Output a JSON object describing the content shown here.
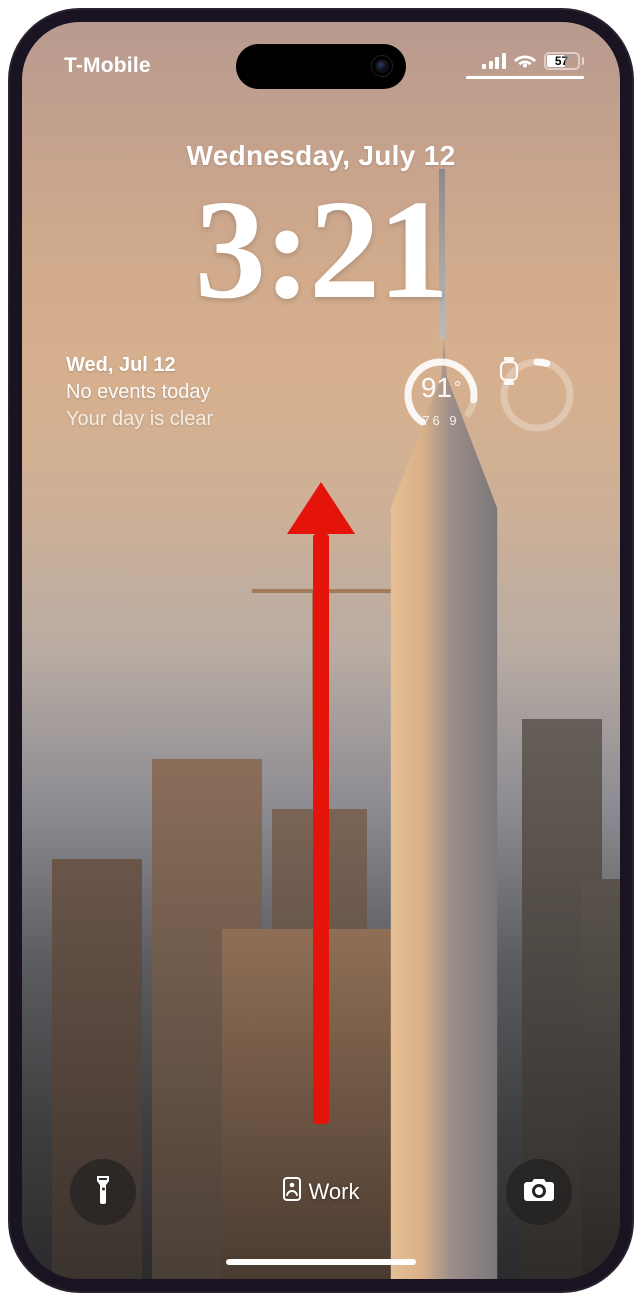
{
  "status_bar": {
    "carrier": "T-Mobile",
    "battery_percent": "57"
  },
  "lockscreen": {
    "date": "Wednesday, July 12",
    "time": "3:21"
  },
  "widgets": {
    "calendar": {
      "line1": "Wed, Jul 12",
      "line2": "No events today",
      "line3": "Your day is clear"
    },
    "weather": {
      "current": "91",
      "low": "76",
      "high": "9"
    }
  },
  "bottom": {
    "focus_label": "Work"
  },
  "annotation": {
    "gesture": "swipe-up"
  }
}
